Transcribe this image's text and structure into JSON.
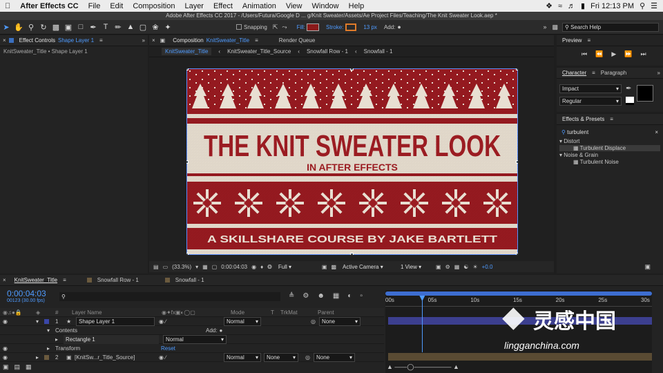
{
  "menubar": {
    "apple_icon": "apple-icon",
    "items": [
      "After Effects CC",
      "File",
      "Edit",
      "Composition",
      "Layer",
      "Effect",
      "Animation",
      "View",
      "Window",
      "Help"
    ],
    "clock": "Fri 12:13 PM",
    "battery": "100%"
  },
  "titlebar": {
    "text": "Adobe After Effects CC 2017 - /Users/Futura/Google D ... g/Knit Sweater/Assets/Ae Project Files/Teaching/The Knit Sweater Look.aep *"
  },
  "toolbar": {
    "snapping_label": "Snapping",
    "fill_label": "Fill:",
    "stroke_label": "Stroke:",
    "stroke_width": "13 px",
    "add_label": "Add:",
    "search_placeholder": "Search Help",
    "fill_color": "#8a1a1a",
    "stroke_color": "#e07b2a"
  },
  "effect_controls": {
    "tab_prefix": "Effect Controls",
    "tab_layer": "Shape Layer 1",
    "breadcrumb": "KnitSweater_Title • Shape Layer 1"
  },
  "composition": {
    "tab_prefix": "Composition",
    "tab_name": "KnitSweater_Title",
    "render_queue": "Render Queue",
    "flow": [
      "KnitSweater_Title",
      "KnitSweater_Title_Source",
      "Snowfall Row - 1",
      "Snowfall - 1"
    ],
    "zoom": "(33.3%)",
    "timecode": "0:00:04:03",
    "resolution": "Full",
    "camera": "Active Camera",
    "views": "1 View",
    "exposure": "+0.0"
  },
  "artwork": {
    "title": "THE KNIT SWEATER LOOK",
    "subtitle": "IN AFTER EFFECTS",
    "footer": "A SKILLSHARE COURSE BY JAKE BARTLETT",
    "red": "#9b1c22",
    "cream": "#e8dfd2"
  },
  "preview": {
    "title": "Preview"
  },
  "character": {
    "tab": "Character",
    "tab2": "Paragraph",
    "font": "Impact",
    "style": "Regular"
  },
  "effects_presets": {
    "title": "Effects & Presets",
    "search": "turbulent",
    "groups": [
      {
        "name": "Distort",
        "items": [
          "Turbulent Displace"
        ]
      },
      {
        "name": "Noise & Grain",
        "items": [
          "Turbulent Noise"
        ]
      }
    ]
  },
  "timeline": {
    "tabs": [
      "KnitSweater_Title",
      "Snowfall Row - 1",
      "Snowfall - 1"
    ],
    "timecode": "0:00:04:03",
    "frame_info": "00123 (30.00 fps)",
    "search_placeholder": "",
    "columns": {
      "num": "#",
      "layer_name": "Layer Name",
      "mode": "Mode",
      "t": "T",
      "trkmat": "TrkMat",
      "parent": "Parent"
    },
    "ruler": [
      "00s",
      "05s",
      "10s",
      "15s",
      "20s",
      "25s",
      "30s"
    ],
    "layers": [
      {
        "num": "1",
        "name": "Shape Layer 1",
        "mode": "Normal",
        "trkmat": "",
        "parent": "None",
        "contents": "Contents",
        "add": "Add:",
        "rect": "Rectangle 1",
        "rect_mode": "Normal",
        "transform": "Transform",
        "reset": "Reset"
      },
      {
        "num": "2",
        "name": "[KnitSw...r_Title_Source]",
        "mode": "Normal",
        "trkmat": "None",
        "parent": "None"
      }
    ],
    "playhead_fraction": 0.137
  },
  "watermark": {
    "brand": "灵感中国",
    "url": "lingganchina.com"
  }
}
